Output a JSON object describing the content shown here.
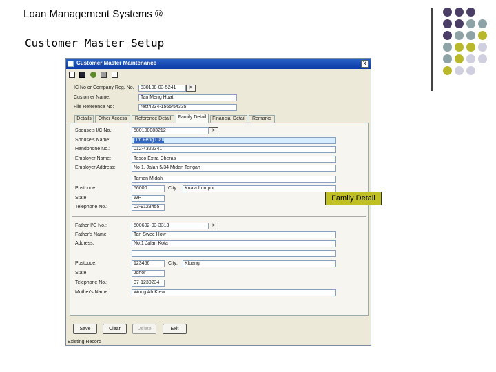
{
  "slide": {
    "title": "Loan Management Systems ®",
    "subtitle": "Customer Master Setup"
  },
  "colors": {
    "purple": "#4a3d66",
    "slate": "#8da3a6",
    "olive": "#b9b82c",
    "lavender": "#cfcfe0",
    "titlebar": "#0a3aa6",
    "callout": "#c0c025"
  },
  "window": {
    "title": "Customer Master Maintenance",
    "close_glyph": "X",
    "toolbar_icons": [
      "new-icon",
      "save-icon",
      "edit-icon",
      "print-icon",
      "exit-icon"
    ]
  },
  "header_fields": {
    "ic_label": "IC No or Company Reg. No.",
    "ic_value": "830108-03-5241",
    "name_label": "Customer Name:",
    "name_value": "Tan Meng Huat",
    "file_label": "File Reference No:",
    "file_value": "refz4234-1565/54335"
  },
  "tabs": [
    "Details",
    "Other Access",
    "Reference Detail",
    "Family Detail",
    "Financial Detail",
    "Remarks"
  ],
  "spouse": {
    "ic_label": "Spouse's I/C No.:",
    "ic_value": "580108083212",
    "name_label": "Spouse's Name:",
    "name_value": "Lim Feng Lian",
    "phone_label": "Handphone No.:",
    "phone_value": "012-4322341",
    "employer_label": "Employer Name:",
    "employer_value": "Tesco Extra Cheras",
    "address_label": "Employer Address:",
    "address_line1": "No 1, Jalan 5/34 Midan Tengah",
    "address_line2": "Taman Midah",
    "postcode_label": "Postcode",
    "postcode_value": "56000",
    "city_label": "City:",
    "city_value": "Kuala Lumpur",
    "state_label": "State:",
    "state_value": "WP",
    "tel_label": "Telephone No.:",
    "tel_value": "03-9123455"
  },
  "father": {
    "ic_label": "Father I/C No.:",
    "ic_value": "500602-03-3313",
    "name_label": "Father's Name:",
    "name_value": "Tan Swee How",
    "address_label": "Address:",
    "address_line1": "No.1 Jalan Kota",
    "postcode_label": "Postcode:",
    "postcode_value": "123456",
    "city_label": "City:",
    "city_value": "Kluang",
    "state_label": "State:",
    "state_value": "Johor",
    "tel_label": "Telephone No.:",
    "tel_value": "07-1230234",
    "mother_label": "Mother's Name:",
    "mother_value": "Wong Ah Kiew"
  },
  "buttons": {
    "save": "Save",
    "clear": "Clear",
    "delete": "Delete",
    "exit": "Exit"
  },
  "lookup_glyph": ">",
  "status": "Existing Record",
  "callout": "Family Detail"
}
